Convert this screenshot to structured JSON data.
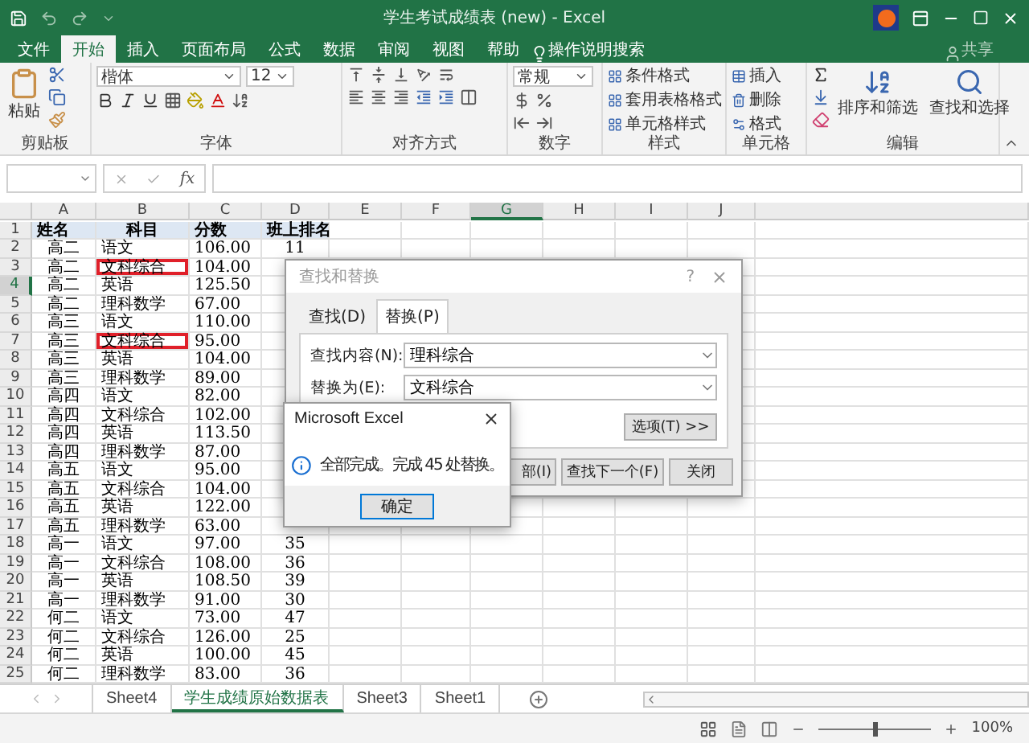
{
  "window": {
    "title": "学生考试成绩表 (new) - Excel"
  },
  "menu_tabs": [
    {
      "label": "文件",
      "selected": false
    },
    {
      "label": "开始",
      "selected": true
    },
    {
      "label": "插入",
      "selected": false
    },
    {
      "label": "页面布局",
      "selected": false
    },
    {
      "label": "公式",
      "selected": false
    },
    {
      "label": "数据",
      "selected": false
    },
    {
      "label": "审阅",
      "selected": false
    },
    {
      "label": "视图",
      "selected": false
    },
    {
      "label": "帮助",
      "selected": false
    }
  ],
  "tell_me": "操作说明搜索",
  "share": "共享",
  "ribbon": {
    "paste": "粘贴",
    "font_name": "楷体",
    "font_size": "12",
    "number_format": "常规",
    "styles": [
      "条件格式",
      "套用表格格式",
      "单元格样式"
    ],
    "cells": [
      "插入",
      "删除",
      "格式"
    ],
    "sort": "排序和筛选",
    "find": "查找和选择",
    "group_labels": [
      "剪贴板",
      "字体",
      "对齐方式",
      "数字",
      "样式",
      "单元格",
      "编辑"
    ]
  },
  "formula_bar": {
    "function_label": "fx"
  },
  "grid": {
    "columns": [
      {
        "label": "A",
        "selected": false
      },
      {
        "label": "B",
        "selected": false
      },
      {
        "label": "C",
        "selected": false
      },
      {
        "label": "D",
        "selected": false
      },
      {
        "label": "E",
        "selected": false
      },
      {
        "label": "F",
        "selected": false
      },
      {
        "label": "G",
        "selected": true
      },
      {
        "label": "H",
        "selected": false
      },
      {
        "label": "I",
        "selected": false
      },
      {
        "label": "J",
        "selected": false
      }
    ],
    "rows": [
      {
        "number": "1",
        "kind": "header",
        "cells": [
          "姓名",
          "科目",
          "分数",
          "班上排名"
        ],
        "selected": false,
        "highlighted": false
      },
      {
        "number": "2",
        "kind": "data",
        "cells": [
          "高二",
          "语文",
          "106.00",
          "11"
        ],
        "selected": false,
        "highlighted": false
      },
      {
        "number": "3",
        "kind": "data",
        "cells": [
          "高二",
          "文科综合",
          "104.00",
          ""
        ],
        "selected": false,
        "highlighted": true
      },
      {
        "number": "4",
        "kind": "data",
        "cells": [
          "高二",
          "英语",
          "125.50",
          ""
        ],
        "selected": true,
        "highlighted": false
      },
      {
        "number": "5",
        "kind": "data",
        "cells": [
          "高二",
          "理科数学",
          "67.00",
          ""
        ],
        "selected": false,
        "highlighted": false
      },
      {
        "number": "6",
        "kind": "data",
        "cells": [
          "高三",
          "语文",
          "110.00",
          ""
        ],
        "selected": false,
        "highlighted": false
      },
      {
        "number": "7",
        "kind": "data",
        "cells": [
          "高三",
          "文科综合",
          "95.00",
          ""
        ],
        "selected": false,
        "highlighted": true
      },
      {
        "number": "8",
        "kind": "data",
        "cells": [
          "高三",
          "英语",
          "104.00",
          ""
        ],
        "selected": false,
        "highlighted": false
      },
      {
        "number": "9",
        "kind": "data",
        "cells": [
          "高三",
          "理科数学",
          "89.00",
          ""
        ],
        "selected": false,
        "highlighted": false
      },
      {
        "number": "10",
        "kind": "data",
        "cells": [
          "高四",
          "语文",
          "82.00",
          ""
        ],
        "selected": false,
        "highlighted": false
      },
      {
        "number": "11",
        "kind": "data",
        "cells": [
          "高四",
          "文科综合",
          "102.00",
          ""
        ],
        "selected": false,
        "highlighted": false
      },
      {
        "number": "12",
        "kind": "data",
        "cells": [
          "高四",
          "英语",
          "113.50",
          ""
        ],
        "selected": false,
        "highlighted": false
      },
      {
        "number": "13",
        "kind": "data",
        "cells": [
          "高四",
          "理科数学",
          "87.00",
          ""
        ],
        "selected": false,
        "highlighted": false
      },
      {
        "number": "14",
        "kind": "data",
        "cells": [
          "高五",
          "语文",
          "95.00",
          ""
        ],
        "selected": false,
        "highlighted": false
      },
      {
        "number": "15",
        "kind": "data",
        "cells": [
          "高五",
          "文科综合",
          "104.00",
          ""
        ],
        "selected": false,
        "highlighted": false
      },
      {
        "number": "16",
        "kind": "data",
        "cells": [
          "高五",
          "英语",
          "122.00",
          ""
        ],
        "selected": false,
        "highlighted": false
      },
      {
        "number": "17",
        "kind": "data",
        "cells": [
          "高五",
          "理科数学",
          "63.00",
          ""
        ],
        "selected": false,
        "highlighted": false
      },
      {
        "number": "18",
        "kind": "data",
        "cells": [
          "高一",
          "语文",
          "97.00",
          "35"
        ],
        "selected": false,
        "highlighted": false
      },
      {
        "number": "19",
        "kind": "data",
        "cells": [
          "高一",
          "文科综合",
          "108.00",
          "36"
        ],
        "selected": false,
        "highlighted": false
      },
      {
        "number": "20",
        "kind": "data",
        "cells": [
          "高一",
          "英语",
          "108.50",
          "39"
        ],
        "selected": false,
        "highlighted": false
      },
      {
        "number": "21",
        "kind": "data",
        "cells": [
          "高一",
          "理科数学",
          "91.00",
          "30"
        ],
        "selected": false,
        "highlighted": false
      },
      {
        "number": "22",
        "kind": "data",
        "cells": [
          "何二",
          "语文",
          "73.00",
          "47"
        ],
        "selected": false,
        "highlighted": false
      },
      {
        "number": "23",
        "kind": "data",
        "cells": [
          "何二",
          "文科综合",
          "126.00",
          "25"
        ],
        "selected": false,
        "highlighted": false
      },
      {
        "number": "24",
        "kind": "data",
        "cells": [
          "何二",
          "英语",
          "100.00",
          "45"
        ],
        "selected": false,
        "highlighted": false
      },
      {
        "number": "25",
        "kind": "data",
        "cells": [
          "何二",
          "理科数学",
          "83.00",
          "36"
        ],
        "selected": false,
        "highlighted": false
      }
    ]
  },
  "find_dialog": {
    "title": "查找和替换",
    "help": "?",
    "tabs": [
      {
        "label": "查找(D)",
        "selected": false
      },
      {
        "label": "替换(P)",
        "selected": true
      }
    ],
    "fields": [
      {
        "label": "查找内容(N):",
        "value": "理科综合"
      },
      {
        "label": "替换为(E):",
        "value": "文科综合"
      }
    ],
    "options_button": "选项(T) >>",
    "buttons": [
      "部(I)",
      "查找下一个(F)",
      "关闭"
    ]
  },
  "message_box": {
    "title": "Microsoft Excel",
    "message": "全部完成。完成 45 处替换。",
    "button": "确定"
  },
  "sheets": [
    {
      "label": "Sheet4",
      "selected": false
    },
    {
      "label": "学生成绩原始数据表",
      "selected": true
    },
    {
      "label": "Sheet3",
      "selected": false
    },
    {
      "label": "Sheet1",
      "selected": false
    }
  ],
  "status_bar": {
    "zoom": "100%",
    "level": 0.5
  }
}
